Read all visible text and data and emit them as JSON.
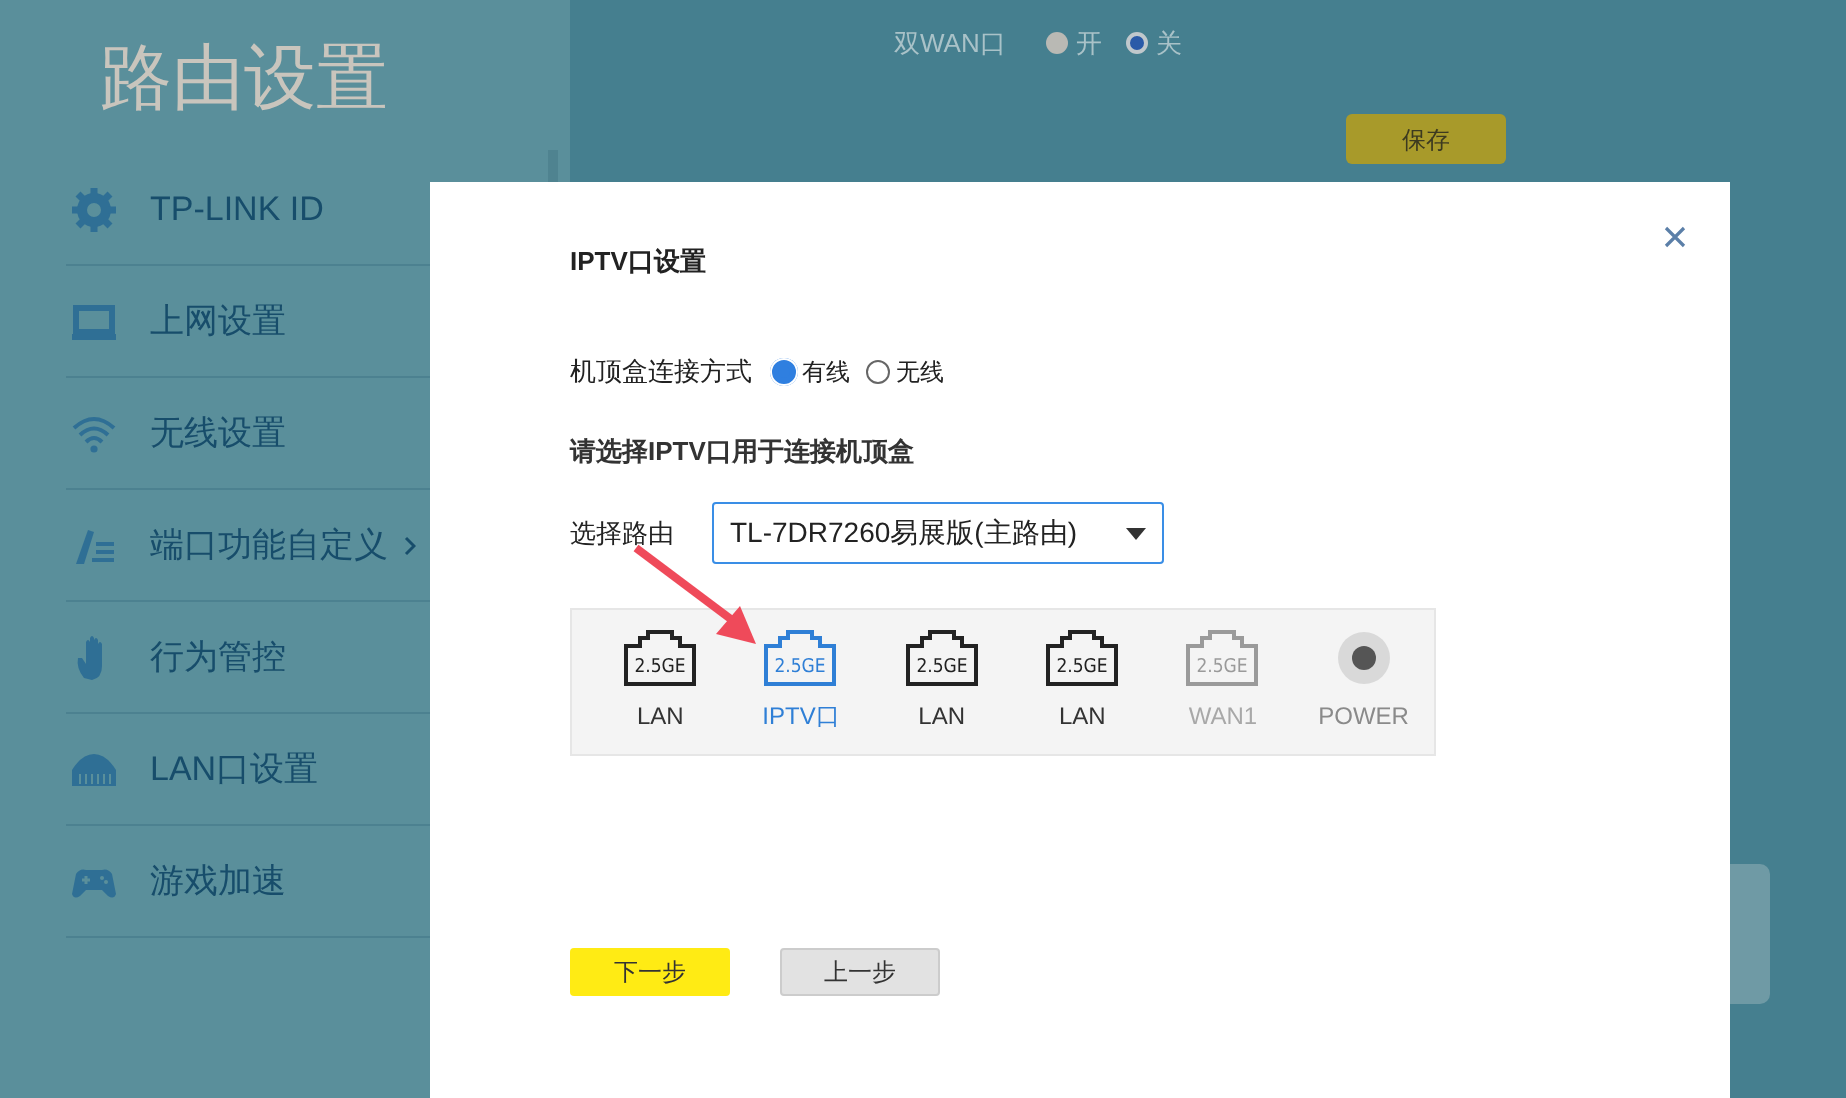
{
  "sidebar": {
    "title": "路由设置",
    "items": [
      {
        "label": "TP-LINK ID",
        "has_submenu": false
      },
      {
        "label": "上网设置",
        "has_submenu": false
      },
      {
        "label": "无线设置",
        "has_submenu": false
      },
      {
        "label": "端口功能自定义",
        "has_submenu": true
      },
      {
        "label": "行为管控",
        "has_submenu": false
      },
      {
        "label": "LAN口设置",
        "has_submenu": false
      },
      {
        "label": "游戏加速",
        "has_submenu": false
      }
    ]
  },
  "background": {
    "dual_wan": {
      "label": "双WAN口",
      "options": [
        {
          "label": "开",
          "selected": false
        },
        {
          "label": "关",
          "selected": true
        }
      ]
    },
    "save_button": "保存"
  },
  "dialog": {
    "title": "IPTV口设置",
    "connection": {
      "label": "机顶盒连接方式",
      "options": [
        {
          "label": "有线",
          "selected": true
        },
        {
          "label": "无线",
          "selected": false
        }
      ]
    },
    "heading": "请选择IPTV口用于连接机顶盒",
    "router_select": {
      "label": "选择路由",
      "value": "TL-7DR7260易展版(主路由)"
    },
    "ports": [
      {
        "kind": "port",
        "badge": "2.5GE",
        "label": "LAN",
        "selected": false,
        "disabled": false
      },
      {
        "kind": "port",
        "badge": "2.5GE",
        "label": "IPTV口",
        "selected": true,
        "disabled": false
      },
      {
        "kind": "port",
        "badge": "2.5GE",
        "label": "LAN",
        "selected": false,
        "disabled": false
      },
      {
        "kind": "port",
        "badge": "2.5GE",
        "label": "LAN",
        "selected": false,
        "disabled": false
      },
      {
        "kind": "port",
        "badge": "2.5GE",
        "label": "WAN1",
        "selected": false,
        "disabled": true
      },
      {
        "kind": "power",
        "label": "POWER"
      }
    ],
    "buttons": [
      {
        "label": "下一步",
        "kind": "primary"
      },
      {
        "label": "上一步",
        "kind": "secondary"
      }
    ]
  }
}
